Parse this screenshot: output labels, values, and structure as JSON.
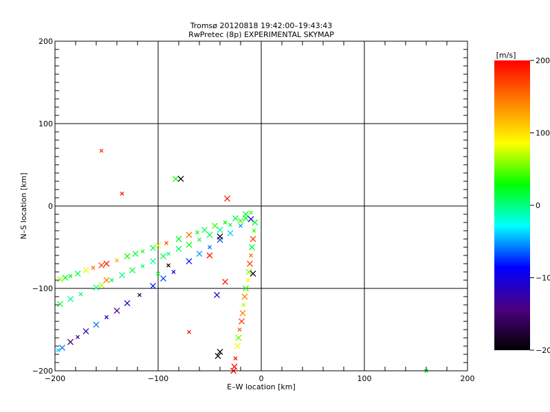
{
  "chart_data": {
    "type": "scatter",
    "title": "Tromsø 20120818  19:42:00–19:43:43",
    "subtitle": "RwPretec (8p) EXPERIMENTAL SKYMAP",
    "xlabel": "E–W location [km]",
    "ylabel": "N–S location [km]",
    "xlim": [
      -200,
      200
    ],
    "ylim": [
      -200,
      200
    ],
    "xticks": [
      "−200",
      "−100",
      "0",
      "100",
      "200"
    ],
    "yticks": [
      "−200",
      "−100",
      "0",
      "100",
      "200"
    ],
    "xtick_values": [
      -200,
      -100,
      0,
      100,
      200
    ],
    "ytick_values": [
      -200,
      -100,
      0,
      100,
      200
    ],
    "grid": true,
    "colorbar": {
      "label": "[m/s]",
      "range": [
        -200,
        200
      ],
      "ticks": [
        "200",
        "100",
        "0",
        "−100",
        "−200"
      ],
      "tick_values": [
        200,
        100,
        0,
        -100,
        -200
      ],
      "colors": [
        "#000000",
        "#4b0082",
        "#0000ff",
        "#00ffff",
        "#00ff00",
        "#ffff00",
        "#ff8000",
        "#ff0000"
      ]
    },
    "point_fields": [
      "x_km",
      "y_km",
      "velocity_m_s"
    ],
    "points": [
      [
        -195,
        -89,
        60
      ],
      [
        -190,
        -87,
        20
      ],
      [
        -185,
        -85,
        30
      ],
      [
        -178,
        -82,
        10
      ],
      [
        -170,
        -78,
        80
      ],
      [
        -163,
        -75,
        150
      ],
      [
        -155,
        -72,
        170
      ],
      [
        -150,
        -70,
        190
      ],
      [
        -140,
        -66,
        120
      ],
      [
        -130,
        -61,
        30
      ],
      [
        -122,
        -58,
        20
      ],
      [
        -115,
        -55,
        40
      ],
      [
        -105,
        -51,
        10
      ],
      [
        -100,
        -48,
        80
      ],
      [
        -92,
        -45,
        160
      ],
      [
        -80,
        -40,
        20
      ],
      [
        -70,
        -35,
        150
      ],
      [
        -62,
        -32,
        30
      ],
      [
        -55,
        -29,
        10
      ],
      [
        -45,
        -24,
        40
      ],
      [
        -35,
        -20,
        30
      ],
      [
        -25,
        -15,
        10
      ],
      [
        -15,
        -10,
        20
      ],
      [
        -10,
        -8,
        40
      ],
      [
        -195,
        -119,
        10
      ],
      [
        -185,
        -113,
        0
      ],
      [
        -175,
        -107,
        5
      ],
      [
        -160,
        -99,
        0
      ],
      [
        -155,
        -96,
        70
      ],
      [
        -145,
        -90,
        10
      ],
      [
        -135,
        -84,
        0
      ],
      [
        -125,
        -78,
        20
      ],
      [
        -115,
        -73,
        5
      ],
      [
        -105,
        -67,
        0
      ],
      [
        -95,
        -61,
        10
      ],
      [
        -90,
        -58,
        0
      ],
      [
        -80,
        -52,
        10
      ],
      [
        -70,
        -47,
        30
      ],
      [
        -60,
        -41,
        15
      ],
      [
        -50,
        -35,
        10
      ],
      [
        -40,
        -29,
        0
      ],
      [
        -30,
        -23,
        10
      ],
      [
        -20,
        -18,
        40
      ],
      [
        -15,
        -15,
        20
      ],
      [
        -197,
        -175,
        -40
      ],
      [
        -193,
        -172,
        -60
      ],
      [
        -185,
        -165,
        -150
      ],
      [
        -178,
        -159,
        -130
      ],
      [
        -170,
        -152,
        -120
      ],
      [
        -160,
        -144,
        -60
      ],
      [
        -150,
        -135,
        -100
      ],
      [
        -140,
        -127,
        -140
      ],
      [
        -130,
        -118,
        -110
      ],
      [
        -118,
        -108,
        -170
      ],
      [
        -105,
        -97,
        -80
      ],
      [
        -95,
        -88,
        -70
      ],
      [
        -85,
        -80,
        -100
      ],
      [
        -70,
        -67,
        -80
      ],
      [
        -60,
        -58,
        -50
      ],
      [
        -50,
        -50,
        -60
      ],
      [
        -40,
        -41,
        -70
      ],
      [
        -30,
        -33,
        -40
      ],
      [
        -20,
        -24,
        -50
      ],
      [
        -10,
        -16,
        -110
      ],
      [
        -6,
        -20,
        20
      ],
      [
        -7,
        -30,
        40
      ],
      [
        -8,
        -40,
        170
      ],
      [
        -9,
        -50,
        20
      ],
      [
        -10,
        -60,
        150
      ],
      [
        -11,
        -70,
        170
      ],
      [
        -12,
        -80,
        60
      ],
      [
        -13,
        -90,
        90
      ],
      [
        -15,
        -100,
        40
      ],
      [
        -16,
        -110,
        140
      ],
      [
        -17,
        -120,
        70
      ],
      [
        -18,
        -130,
        140
      ],
      [
        -19,
        -140,
        170
      ],
      [
        -21,
        -150,
        160
      ],
      [
        -22,
        -160,
        50
      ],
      [
        -23,
        -170,
        90
      ],
      [
        -25,
        -185,
        190
      ],
      [
        -26,
        -195,
        200
      ],
      [
        -27,
        -200,
        190
      ],
      [
        -135,
        15,
        190
      ],
      [
        -83,
        33,
        30
      ],
      [
        -33,
        9,
        190
      ],
      [
        -155,
        67,
        180
      ],
      [
        -78,
        33,
        -200
      ],
      [
        -40,
        -37,
        -200
      ],
      [
        -90,
        -72,
        -200
      ],
      [
        -40,
        -177,
        -200
      ],
      [
        -42,
        -182,
        -200
      ],
      [
        -70,
        -153,
        190
      ],
      [
        -43,
        -108,
        -120
      ],
      [
        -35,
        -92,
        190
      ],
      [
        160,
        -200,
        20
      ],
      [
        -8,
        -82,
        -200
      ],
      [
        -50,
        -60,
        190
      ],
      [
        -100,
        -82,
        20
      ],
      [
        -150,
        -90,
        140
      ]
    ]
  }
}
